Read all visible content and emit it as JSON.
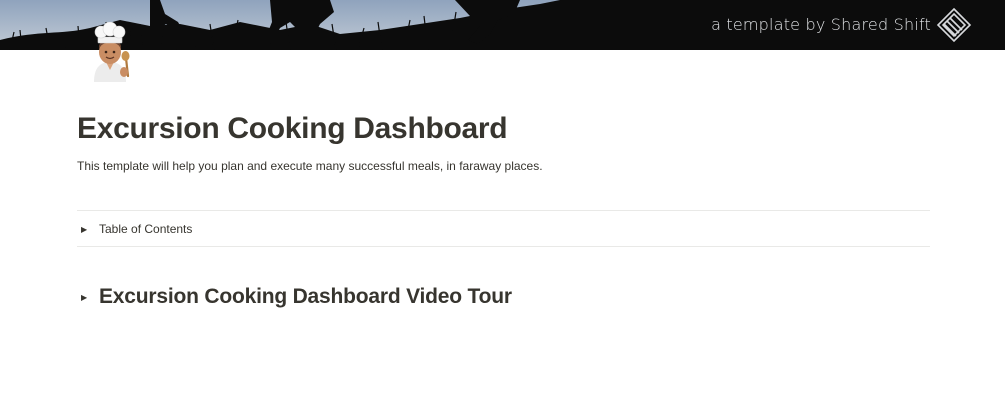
{
  "cover": {
    "credit_text": "a template by Shared Shift",
    "logo_icon": "shared-shift-logo-icon",
    "sky_color": "#a9b8cc",
    "silhouette_color": "#0c0c0c"
  },
  "page": {
    "icon": "cook-emoji-icon",
    "title": "Excursion Cooking Dashboard",
    "description": "This template will help you plan and execute many successful meals, in faraway places."
  },
  "toc_toggle": {
    "arrow": "▶",
    "label": "Table of Contents"
  },
  "tour_toggle": {
    "arrow": "▶",
    "label": "Excursion Cooking Dashboard Video Tour"
  }
}
